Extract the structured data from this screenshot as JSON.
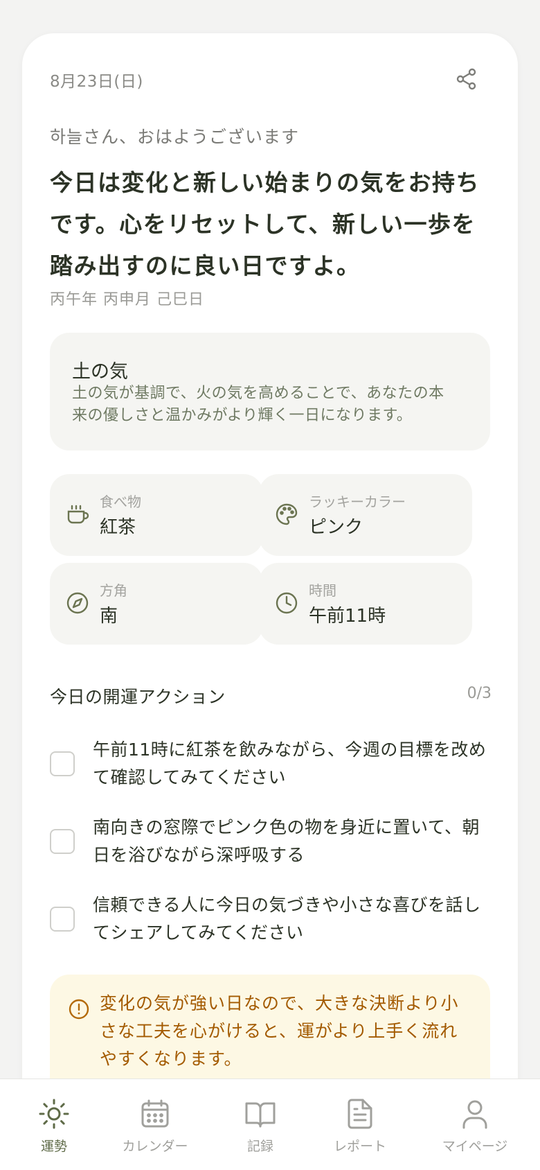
{
  "header": {
    "date": "8月23日(日)",
    "share_icon": "share-icon"
  },
  "fortune": {
    "greeting": "하늘さん、おはようございます",
    "headline": "今日は変化と新しい始まりの気をお持ちです。心をリセットして、新しい一歩を踏み出すのに良い日ですよ。",
    "ganzhi": "丙午年 丙申月 己巳日"
  },
  "element": {
    "title": "土の気",
    "description": "土の気が基調で、火の気を高めることで、あなたの本来の優しさと温かみがより輝く一日になります。"
  },
  "lucky": [
    {
      "icon": "cup-icon",
      "label": "食べ物",
      "value": "紅茶"
    },
    {
      "icon": "palette-icon",
      "label": "ラッキーカラー",
      "value": "ピンク"
    },
    {
      "icon": "compass-icon",
      "label": "方角",
      "value": "南"
    },
    {
      "icon": "clock-icon",
      "label": "時間",
      "value": "午前11時"
    }
  ],
  "actions": {
    "title": "今日の開運アクション",
    "count": "0/3",
    "items": [
      {
        "text": "午前11時に紅茶を飲みながら、今週の目標を改めて確認してみてください",
        "checked": false
      },
      {
        "text": "南向きの窓際でピンク色の物を身近に置いて、朝日を浴びながら深呼吸する",
        "checked": false
      },
      {
        "text": "信頼できる人に今日の気づきや小さな喜びを話してシェアしてみてください",
        "checked": false
      }
    ]
  },
  "notice": {
    "icon": "alert-circle-icon",
    "text": "変化の気が強い日なので、大きな決断より小さな工夫を心がけると、運がより上手く流れやすくなります。"
  },
  "tabbar": {
    "active_color": "#5f6b48",
    "inactive_color": "#a0a09c",
    "items": [
      {
        "icon": "sun-icon",
        "label": "運勢",
        "active": true
      },
      {
        "icon": "calendar-icon",
        "label": "カレンダー",
        "active": false
      },
      {
        "icon": "book-icon",
        "label": "記録",
        "active": false
      },
      {
        "icon": "document-icon",
        "label": "レポート",
        "active": false
      },
      {
        "icon": "person-icon",
        "label": "マイページ",
        "active": false
      }
    ]
  }
}
